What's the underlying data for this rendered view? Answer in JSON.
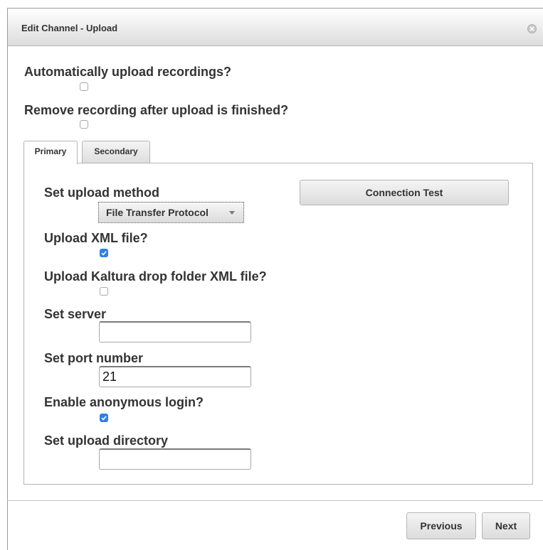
{
  "dialog": {
    "title": "Edit Channel - Upload",
    "close_icon": "close-icon"
  },
  "general": {
    "auto_upload_label": "Automatically upload recordings?",
    "auto_upload_checked": false,
    "remove_after_upload_label": "Remove recording after upload is finished?",
    "remove_after_upload_checked": false
  },
  "tabs": [
    {
      "label": "Primary",
      "active": true
    },
    {
      "label": "Secondary",
      "active": false
    }
  ],
  "primary": {
    "upload_method_label": "Set upload method",
    "upload_method_value": "File Transfer Protocol",
    "connection_test_label": "Connection Test",
    "upload_xml_label": "Upload XML file?",
    "upload_xml_checked": true,
    "kaltura_label": "Upload Kaltura drop folder XML file?",
    "kaltura_checked": false,
    "server_label": "Set server",
    "server_value": "",
    "port_label": "Set port number",
    "port_value": "21",
    "anonymous_label": "Enable anonymous login?",
    "anonymous_checked": true,
    "directory_label": "Set upload directory",
    "directory_value": ""
  },
  "footer": {
    "previous_label": "Previous",
    "next_label": "Next"
  },
  "colors": {
    "checkbox_checked": "#2f7fe8",
    "titlebar_gradient_bottom": "#dcdcdc"
  }
}
